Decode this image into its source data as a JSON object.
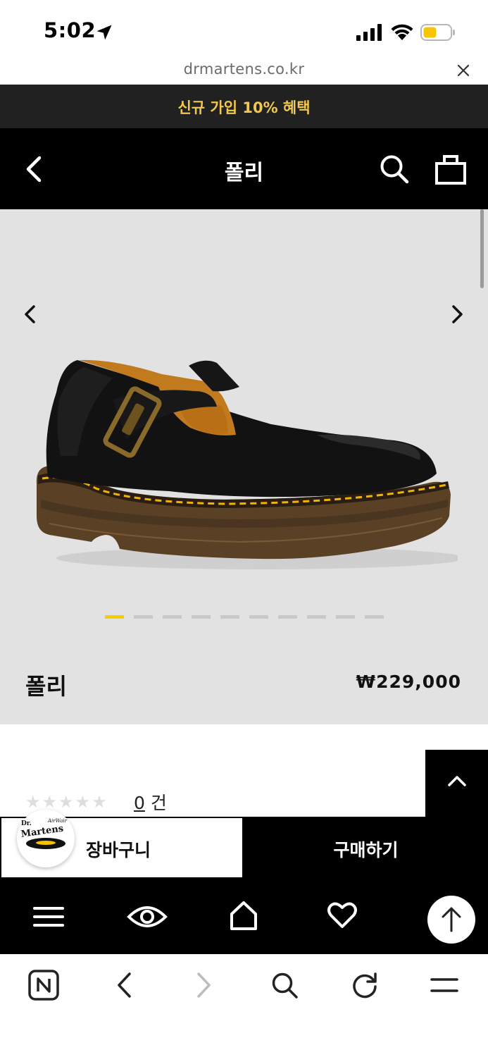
{
  "status_bar": {
    "time": "5:02"
  },
  "browser": {
    "url": "drmartens.co.kr"
  },
  "promo": {
    "text": "신규 가입 10% 혜택"
  },
  "header": {
    "title": "폴리"
  },
  "gallery": {
    "image_count": 10,
    "active_index": 0,
    "active_dot_color": "#f5d000"
  },
  "product": {
    "name": "폴리",
    "price": "₩229,000"
  },
  "reviews": {
    "rating": 0,
    "max_rating": 5,
    "count": "0",
    "count_suffix": "건"
  },
  "actions": {
    "cart_label": "장바구니",
    "buy_label": "구매하기",
    "brand_logo_text": "Dr. Martens AirWair"
  },
  "bottom_nav": {
    "items": [
      "menu-icon",
      "eye-icon",
      "home-icon",
      "heart-icon",
      "arrow-up-icon"
    ]
  },
  "browser_toolbar": {
    "items": [
      "naver-n-icon",
      "back-icon",
      "forward-icon",
      "search-icon",
      "reload-icon",
      "menu-icon"
    ]
  },
  "colors": {
    "promo_text": "#f2c94c",
    "header_bg": "#000000",
    "gallery_bg": "#e2e2e2"
  }
}
